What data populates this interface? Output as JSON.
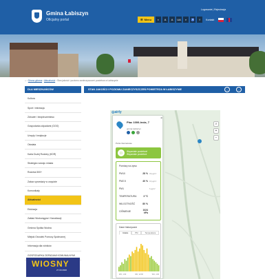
{
  "header": {
    "title": "Gmina Łabiszyn",
    "subtitle": "Oficjalny portal",
    "top_links": "Logowanie | Rejestracja",
    "menu_label": "Menu",
    "toolbar_icons": [
      "contrast-icon",
      "font-a-icon",
      "font-a-plus-icon",
      "ua-icon",
      "search-icon",
      "accessibility-icon",
      "facebook-icon"
    ],
    "contact_label": "Kontakt"
  },
  "breadcrumb": {
    "items": [
      "Strona główna",
      "Aktualności",
      "Stan jakości i poziomu zanieczyszczeń powietrza w Łabiszynie"
    ]
  },
  "sidebar": {
    "title": "DLA MIESZKAŃCÓW",
    "items": [
      {
        "label": "Kultura",
        "active": false
      },
      {
        "label": "Sport i rekreacja",
        "active": false
      },
      {
        "label": "Zdrowie i bezpieczeństwo",
        "active": false
      },
      {
        "label": "Gospodarka odpadami (GOO)",
        "active": false
      },
      {
        "label": "Urzędy i instytucje",
        "active": false
      },
      {
        "label": "Oświata",
        "active": false
      },
      {
        "label": "Karta Dużej Rodziny (KDR)",
        "active": false
      },
      {
        "label": "Strategia rozwoju miasta",
        "active": false
      },
      {
        "label": "Rodzina 500+",
        "active": false
      },
      {
        "label": "Zakaz sprzedaży w urzędzie",
        "active": false
      },
      {
        "label": "Komunikaty",
        "active": false
      },
      {
        "label": "Aktualności",
        "active": true
      },
      {
        "label": "Edukacja",
        "active": false
      },
      {
        "label": "Zakład Wodociągów i Kanalizacji",
        "active": false
      },
      {
        "label": "Gminna Spółka Wodna",
        "active": false
      },
      {
        "label": "Miejski Ośrodek Pomocy Społecznej",
        "active": false
      },
      {
        "label": "Informacja dla rolników",
        "active": false
      },
      {
        "label": "GOSPODARKA ODPADAMI KOMUNALNYMI",
        "active": false
      }
    ],
    "banner_text": "WIOSNY",
    "banner_sub": "27.03.2020"
  },
  "main": {
    "title": "STAN JAKOŚCI I POZIOMU ZANIECZYSZCZEŃ POWIETRZA W ŁABISZYNIE"
  },
  "sensor": {
    "location": "Plac 1000-lecia, 7",
    "location_sub": "gmina Łabiszyn",
    "link": "Porta Internetowe",
    "status_line1": "Wspaniałe powietrze!",
    "status_line2": "Wspaniałe powietrze",
    "readings_title": "Pomiary na żywo",
    "readings": [
      {
        "label": "PM10",
        "value": "28 %",
        "unit": "34 µg/m³"
      },
      {
        "label": "PM2.5",
        "value": "40 %",
        "unit": "10 µg/m³"
      },
      {
        "label": "PM1",
        "value": "",
        "unit": "6 µg/m³"
      },
      {
        "label": "TEMPERATURA",
        "value": "3 °C",
        "unit": ""
      },
      {
        "label": "WILGOTNOŚĆ",
        "value": "80 %",
        "unit": ""
      },
      {
        "label": "CIŚNIENIE",
        "value": "1024 hPa",
        "unit": ""
      }
    ],
    "history_title": "Dane historyczne",
    "history_tabs": [
      "Indeks",
      "PM",
      "Temperatura"
    ],
    "history_dates": [
      "Wrz, 1:00",
      "Wrz, 12:00",
      "Wrz, 1:00"
    ],
    "history_colors": {
      "good": "#f2c417",
      "moderate": "#9ccc3f"
    }
  },
  "chart_data": {
    "type": "bar",
    "values": [
      3,
      4,
      6,
      5,
      8,
      7,
      9,
      11,
      10,
      13,
      12,
      14,
      16,
      13,
      15,
      18,
      17,
      14,
      12,
      15,
      11,
      9,
      10,
      8,
      7,
      6,
      5,
      4
    ]
  }
}
